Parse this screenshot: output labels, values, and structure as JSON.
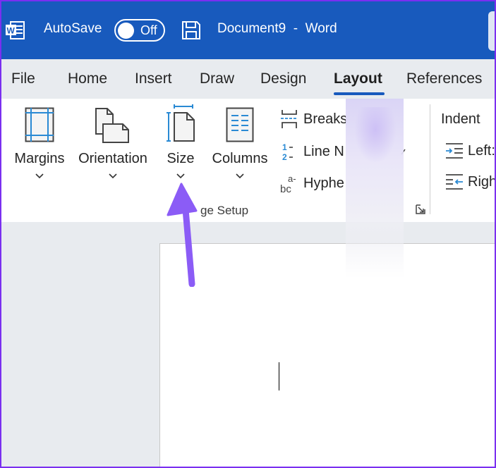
{
  "titlebar": {
    "app_icon": "word-icon",
    "autosave_label": "AutoSave",
    "autosave_state": "Off",
    "save_icon": "save-icon",
    "document_title": "Document9  -  Word"
  },
  "tabs": [
    {
      "label": "File",
      "active": false
    },
    {
      "label": "Home",
      "active": false
    },
    {
      "label": "Insert",
      "active": false
    },
    {
      "label": "Draw",
      "active": false
    },
    {
      "label": "Design",
      "active": false
    },
    {
      "label": "Layout",
      "active": true
    },
    {
      "label": "References",
      "active": false
    }
  ],
  "ribbon": {
    "page_setup": {
      "group_label": "Page Setup",
      "group_label_visible": "ge Setup",
      "large_buttons": [
        {
          "label": "Margins",
          "icon": "margins-icon"
        },
        {
          "label": "Orientation",
          "icon": "orientation-icon"
        },
        {
          "label": "Size",
          "icon": "size-icon"
        },
        {
          "label": "Columns",
          "icon": "columns-icon"
        }
      ],
      "small_buttons": [
        {
          "label": "Breaks",
          "icon": "breaks-icon"
        },
        {
          "label": "Line N",
          "icon": "line-numbers-icon"
        },
        {
          "label": "Hyphe",
          "icon": "hyphenation-icon"
        }
      ],
      "dialog_launcher_icon": "dialog-launcher-icon"
    },
    "paragraph": {
      "indent_title": "Indent",
      "indent_rows": [
        {
          "label": "Left:",
          "icon": "indent-left-icon"
        },
        {
          "label": "Righ",
          "icon": "indent-right-icon"
        }
      ]
    }
  },
  "annotation": {
    "arrow_color": "#8b5cf6",
    "points_to": "Size"
  },
  "colors": {
    "titlebar": "#185abd",
    "accent": "#185abd",
    "icon_blue": "#2a8ad4",
    "frame": "#7a2ff0"
  }
}
